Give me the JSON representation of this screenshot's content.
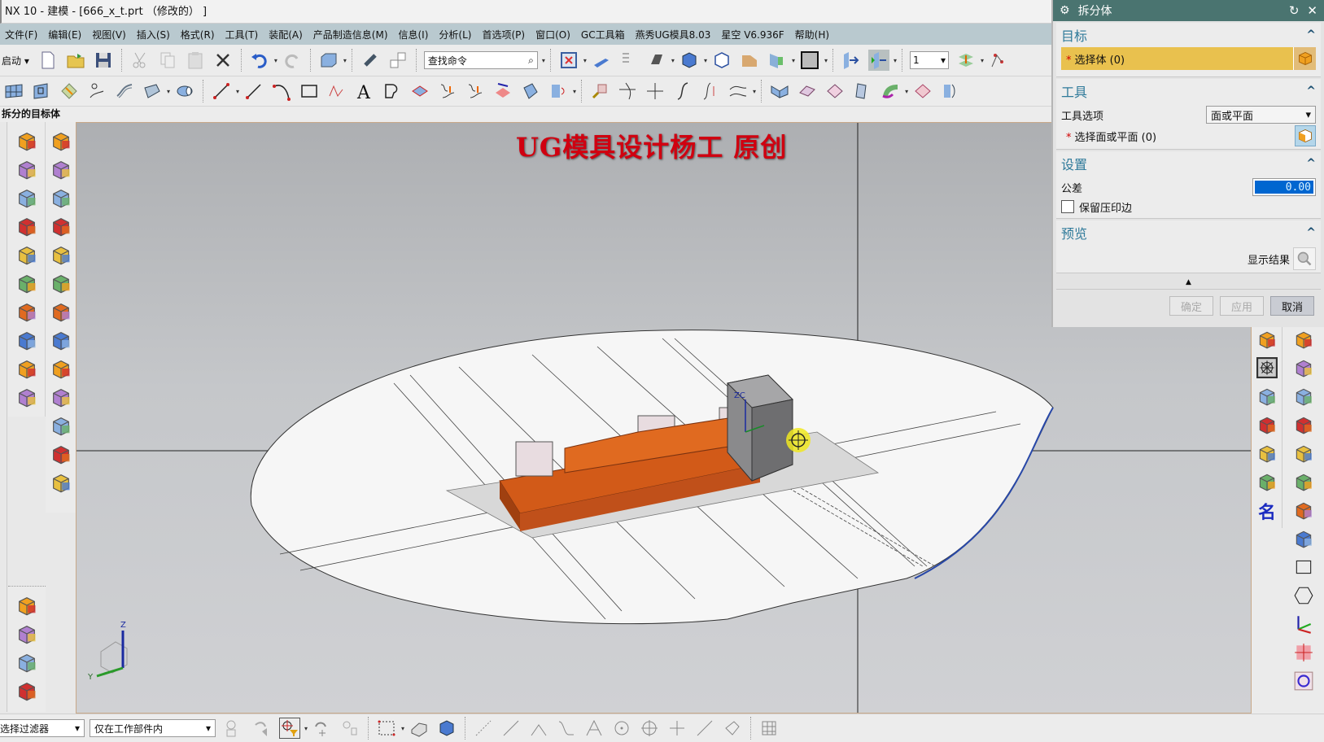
{
  "window": {
    "title": "NX 10 - 建模 - [666_x_t.prt （修改的） ]"
  },
  "menu": [
    "文件(F)",
    "编辑(E)",
    "视图(V)",
    "插入(S)",
    "格式(R)",
    "工具(T)",
    "装配(A)",
    "产品制造信息(M)",
    "信息(I)",
    "分析(L)",
    "首选项(P)",
    "窗口(O)",
    "GC工具箱",
    "燕秀UG模具8.03",
    "星空 V6.936F",
    "帮助(H)"
  ],
  "toolbar": {
    "start_label": "启动",
    "search_placeholder": "查找命令",
    "layer_value": "1",
    "row1_icons": [
      "new-file-icon",
      "open-folder-icon",
      "save-icon",
      "cut-icon",
      "copy-icon",
      "paste-icon",
      "delete-icon",
      "undo-icon",
      "redo-icon",
      "display-part-icon",
      "reposition-icon",
      "switch-window-icon",
      "fit-view-icon",
      "datum-icon",
      "feature-list-icon",
      "shaded-icon",
      "solid-cube-icon",
      "wireframe-cube-icon",
      "orange-section-icon",
      "green-section-icon",
      "background-icon",
      "move-to-layer-icon",
      "work-layer-icon",
      "layer-settings-icon",
      "snap-icon"
    ],
    "row2_icons": [
      "surface-grid-icon",
      "face-icon",
      "swept-icon",
      "studio-surface-icon",
      "through-curves-icon",
      "extension-icon",
      "tube-icon",
      "line-icon",
      "line2-icon",
      "arc-icon",
      "rectangle-icon",
      "spline-icon",
      "text-icon",
      "sketch-icon",
      "offset-face-icon",
      "project-curve-icon",
      "intersect-curve-icon",
      "divide-face-icon",
      "trim-sheet-icon",
      "extract-icon",
      "trim-curve-icon",
      "trim-edge-icon",
      "bridge-icon",
      "join-curve-icon",
      "divide-curve-icon",
      "offset-curve-icon",
      "bounded-plane-icon",
      "sew-icon",
      "patch-icon",
      "ruled-icon",
      "blend-icon",
      "fillet-icon",
      "mirror-icon"
    ]
  },
  "cue_line": "拆分的目标体",
  "viewport": {
    "watermark": "UG模具设计杨工 原创",
    "axis_labels": {
      "z": "Z",
      "y": "Y",
      "zc": "ZC"
    }
  },
  "left_toolbar": [
    "move-face-icon",
    "replace-face-icon",
    "offset-region-icon",
    "delete-face-icon",
    "copy-face-icon",
    "cut-face-icon",
    "resize-face-icon",
    "paste-face-icon",
    "draft-face-icon",
    "move-face2-icon"
  ],
  "left_toolbar2": [
    "solid-box-icon",
    "split-body-icon",
    "trim-body-icon",
    "emboss-icon",
    "red-cube-icon",
    "sheet-face-icon",
    "curved-sheet-icon",
    "orange-surface-icon",
    "yellow-box-icon",
    "split-box-icon",
    "core-cavity-icon",
    "body-swap-icon",
    "transform-icon"
  ],
  "left_toolbar3": [
    "dimension-icon",
    "linear-dim-icon",
    "edit-param-icon",
    "remove-param-icon"
  ],
  "right_toolbar1": [
    "mold-pair-icon",
    "wheel-icon",
    "table-icon",
    "test-icon",
    "flip-icon",
    "mold-pair2-icon",
    "name-icon"
  ],
  "right_toolbar2": [
    "frame-icon",
    "stripe-icon",
    "info-icon",
    "pipe-icon",
    "red-box-icon",
    "section-plane-icon",
    "split-block-icon",
    "origin-block-icon",
    "rectangle-icon",
    "hexagon-icon",
    "csys-icon",
    "point-icon",
    "circle-icon"
  ],
  "dialog": {
    "title": "拆分体",
    "groups": {
      "target": {
        "title": "目标",
        "select_label": "选择体 (0)"
      },
      "tool": {
        "title": "工具",
        "option_label": "工具选项",
        "option_value": "面或平面",
        "select_label": "选择面或平面 (0)"
      },
      "settings": {
        "title": "设置",
        "tolerance_label": "公差",
        "tolerance_value": "0.00",
        "keep_imprint_label": "保留压印边",
        "keep_imprint_checked": false
      },
      "preview": {
        "title": "预览",
        "show_result_label": "显示结果"
      }
    },
    "buttons": {
      "ok": "确定",
      "apply": "应用",
      "cancel": "取消"
    }
  },
  "statusbar": {
    "filter_value": "选择过滤器",
    "scope_value": "仅在工作部件内"
  }
}
